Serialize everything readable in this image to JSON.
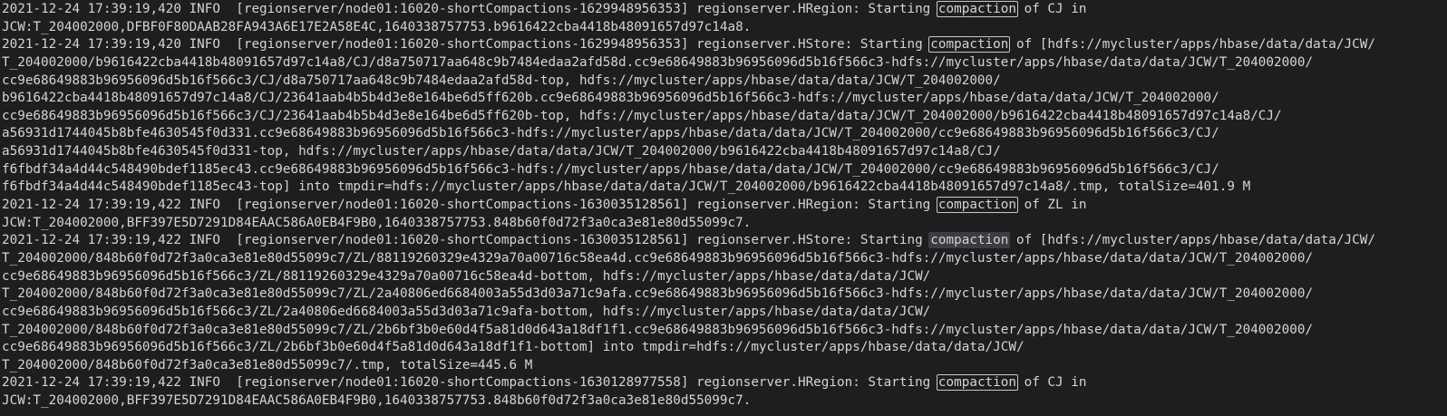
{
  "terminal": {
    "search_term": "compaction",
    "current_match_line": 13,
    "lines": [
      "2021-12-24 17:39:19,420 INFO  [regionserver/node01:16020-shortCompactions-1629948956353] regionserver.HRegion: Starting compaction of CJ in",
      "JCW:T_204002000,DFBF0F80DAAB28FA943A6E17E2A58E4C,1640338757753.b9616422cba4418b48091657d97c14a8.",
      "2021-12-24 17:39:19,420 INFO  [regionserver/node01:16020-shortCompactions-1629948956353] regionserver.HStore: Starting compaction of [hdfs://mycluster/apps/hbase/data/data/JCW/",
      "T_204002000/b9616422cba4418b48091657d97c14a8/CJ/d8a750717aa648c9b7484edaa2afd58d.cc9e68649883b96956096d5b16f566c3-hdfs://mycluster/apps/hbase/data/data/JCW/T_204002000/",
      "cc9e68649883b96956096d5b16f566c3/CJ/d8a750717aa648c9b7484edaa2afd58d-top, hdfs://mycluster/apps/hbase/data/data/JCW/T_204002000/",
      "b9616422cba4418b48091657d97c14a8/CJ/23641aab4b5b4d3e8e164be6d5ff620b.cc9e68649883b96956096d5b16f566c3-hdfs://mycluster/apps/hbase/data/data/JCW/T_204002000/",
      "cc9e68649883b96956096d5b16f566c3/CJ/23641aab4b5b4d3e8e164be6d5ff620b-top, hdfs://mycluster/apps/hbase/data/data/JCW/T_204002000/b9616422cba4418b48091657d97c14a8/CJ/",
      "a56931d1744045b8bfe4630545f0d331.cc9e68649883b96956096d5b16f566c3-hdfs://mycluster/apps/hbase/data/data/JCW/T_204002000/cc9e68649883b96956096d5b16f566c3/CJ/",
      "a56931d1744045b8bfe4630545f0d331-top, hdfs://mycluster/apps/hbase/data/data/JCW/T_204002000/b9616422cba4418b48091657d97c14a8/CJ/",
      "f6fbdf34a4d44c548490bdef1185ec43.cc9e68649883b96956096d5b16f566c3-hdfs://mycluster/apps/hbase/data/data/JCW/T_204002000/cc9e68649883b96956096d5b16f566c3/CJ/",
      "f6fbdf34a4d44c548490bdef1185ec43-top] into tmpdir=hdfs://mycluster/apps/hbase/data/data/JCW/T_204002000/b9616422cba4418b48091657d97c14a8/.tmp, totalSize=401.9 M",
      "2021-12-24 17:39:19,422 INFO  [regionserver/node01:16020-shortCompactions-1630035128561] regionserver.HRegion: Starting compaction of ZL in",
      "JCW:T_204002000,BFF397E5D7291D84EAAC586A0EB4F9B0,1640338757753.848b60f0d72f3a0ca3e81e80d55099c7.",
      "2021-12-24 17:39:19,422 INFO  [regionserver/node01:16020-shortCompactions-1630035128561] regionserver.HStore: Starting compaction of [hdfs://mycluster/apps/hbase/data/data/JCW/",
      "T_204002000/848b60f0d72f3a0ca3e81e80d55099c7/ZL/88119260329e4329a70a00716c58ea4d.cc9e68649883b96956096d5b16f566c3-hdfs://mycluster/apps/hbase/data/data/JCW/T_204002000/",
      "cc9e68649883b96956096d5b16f566c3/ZL/88119260329e4329a70a00716c58ea4d-bottom, hdfs://mycluster/apps/hbase/data/data/JCW/",
      "T_204002000/848b60f0d72f3a0ca3e81e80d55099c7/ZL/2a40806ed6684003a55d3d03a71c9afa.cc9e68649883b96956096d5b16f566c3-hdfs://mycluster/apps/hbase/data/data/JCW/T_204002000/",
      "cc9e68649883b96956096d5b16f566c3/ZL/2a40806ed6684003a55d3d03a71c9afa-bottom, hdfs://mycluster/apps/hbase/data/data/JCW/",
      "T_204002000/848b60f0d72f3a0ca3e81e80d55099c7/ZL/2b6bf3b0e60d4f5a81d0d643a18df1f1.cc9e68649883b96956096d5b16f566c3-hdfs://mycluster/apps/hbase/data/data/JCW/T_204002000/",
      "cc9e68649883b96956096d5b16f566c3/ZL/2b6bf3b0e60d4f5a81d0d643a18df1f1-bottom] into tmpdir=hdfs://mycluster/apps/hbase/data/data/JCW/",
      "T_204002000/848b60f0d72f3a0ca3e81e80d55099c7/.tmp, totalSize=445.6 M",
      "2021-12-24 17:39:19,422 INFO  [regionserver/node01:16020-shortCompactions-1630128977558] regionserver.HRegion: Starting compaction of CJ in",
      "JCW:T_204002000,BFF397E5D7291D84EAAC586A0EB4F9B0,1640338757753.848b60f0d72f3a0ca3e81e80d55099c7."
    ]
  }
}
